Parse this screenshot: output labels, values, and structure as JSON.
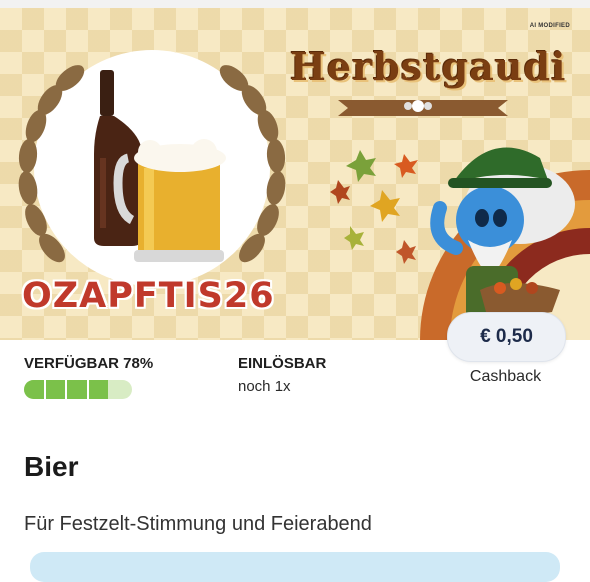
{
  "banner": {
    "ai_badge": "AI MODIFIED",
    "event_title": "Herbstgaudi",
    "promo_code": "OZAPFTIS26"
  },
  "offer": {
    "cashback_amount": "€ 0,50",
    "cashback_label": "Cashback",
    "availability_label": "VERFÜGBAR 78%",
    "availability_fraction": 0.78,
    "redeem_label": "EINLÖSBAR",
    "redeem_value": "noch 1x"
  },
  "product": {
    "title": "Bier",
    "description": "Für Festzelt-Stimmung und Feierabend"
  },
  "colors": {
    "accent_green": "#7bc14a",
    "promo_red": "#c0392b",
    "cashback_text": "#1d2b4a"
  }
}
